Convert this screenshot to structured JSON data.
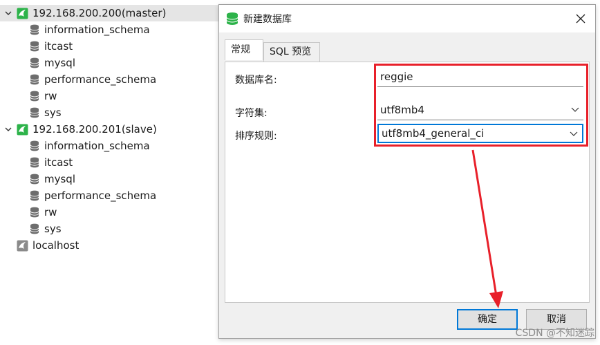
{
  "tree": {
    "connections": [
      {
        "label": "192.168.200.200(master)",
        "expanded": true,
        "selected": true,
        "databases": [
          "information_schema",
          "itcast",
          "mysql",
          "performance_schema",
          "rw",
          "sys"
        ]
      },
      {
        "label": "192.168.200.201(slave)",
        "expanded": true,
        "selected": false,
        "databases": [
          "information_schema",
          "itcast",
          "mysql",
          "performance_schema",
          "rw",
          "sys"
        ]
      },
      {
        "label": "localhost",
        "expanded": false,
        "selected": false,
        "databases": []
      }
    ]
  },
  "dialog": {
    "title": "新建数据库",
    "tabs": [
      "常规",
      "SQL 预览"
    ],
    "fields": {
      "db_name_label": "数据库名:",
      "db_name_value": "reggie",
      "charset_label": "字符集:",
      "charset_value": "utf8mb4",
      "collation_label": "排序规则:",
      "collation_value": "utf8mb4_general_ci"
    },
    "ok_label": "确定",
    "cancel_label": "取消"
  },
  "watermark": "CSDN @不知迷踪",
  "colors": {
    "highlight": "#e8202a",
    "focus": "#0078d7",
    "connection_icon_green": "#2db34a",
    "connection_icon_gray": "#8a8a8a",
    "db_icon": "#6d6d6d"
  },
  "icons": {
    "connection": "mysql-connection-icon",
    "database": "database-icon",
    "expand": "chevron-down-icon",
    "close": "close-icon",
    "dropdown": "chevron-down-icon"
  }
}
